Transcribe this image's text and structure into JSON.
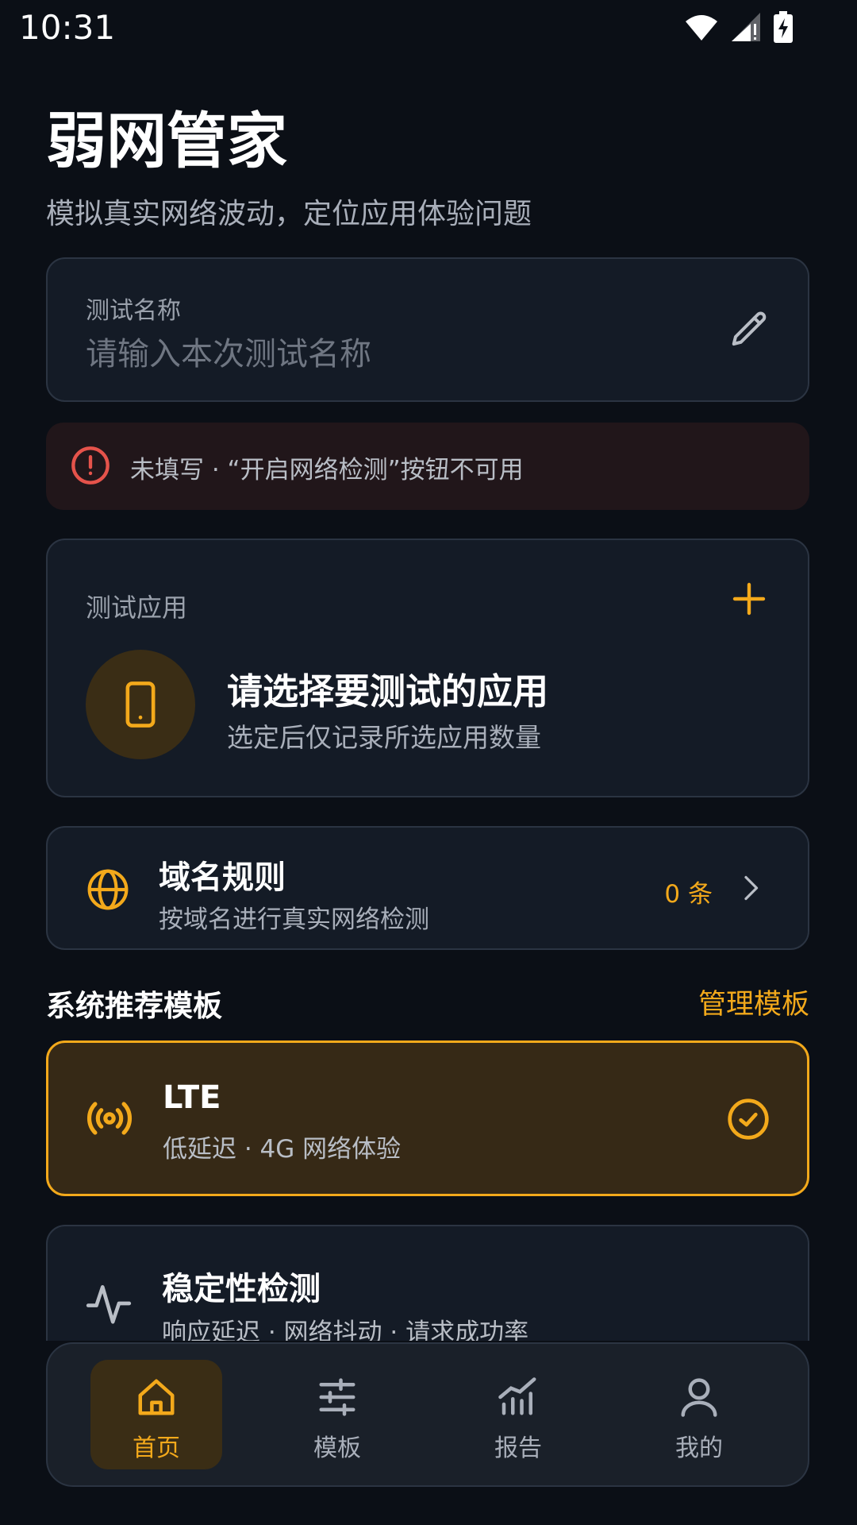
{
  "status_bar": {
    "time": "10:31"
  },
  "app": {
    "title": "弱网管家",
    "subtitle": "模拟真实网络波动，定位应用体验问题"
  },
  "test_name": {
    "label": "测试名称",
    "placeholder": "请输入本次测试名称",
    "value": ""
  },
  "warning": {
    "text": "未填写 · “开启网络检测”按钮不可用"
  },
  "test_app": {
    "label": "测试应用",
    "title": "请选择要测试的应用",
    "subtitle": "选定后仅记录所选应用数量"
  },
  "domain_rules": {
    "title": "域名规则",
    "subtitle": "按域名进行真实网络检测",
    "count": "0 条"
  },
  "templates_section": {
    "title": "系统推荐模板",
    "manage_label": "管理模板"
  },
  "templates": [
    {
      "title": "LTE",
      "subtitle": "低延迟 · 4G 网络体验",
      "selected": true
    },
    {
      "title": "稳定性检测",
      "subtitle": "响应延迟 · 网络抖动 · 请求成功率",
      "selected": false
    }
  ],
  "bottom_nav": [
    {
      "label": "首页",
      "icon": "home-icon",
      "active": true
    },
    {
      "label": "模板",
      "icon": "sliders-icon",
      "active": false
    },
    {
      "label": "报告",
      "icon": "chart-icon",
      "active": false
    },
    {
      "label": "我的",
      "icon": "user-icon",
      "active": false
    }
  ],
  "colors": {
    "background": "#0b0f16",
    "card": "#141b26",
    "accent": "#f3a91b",
    "error": "#e5534b",
    "warning_bg": "#21161a"
  }
}
